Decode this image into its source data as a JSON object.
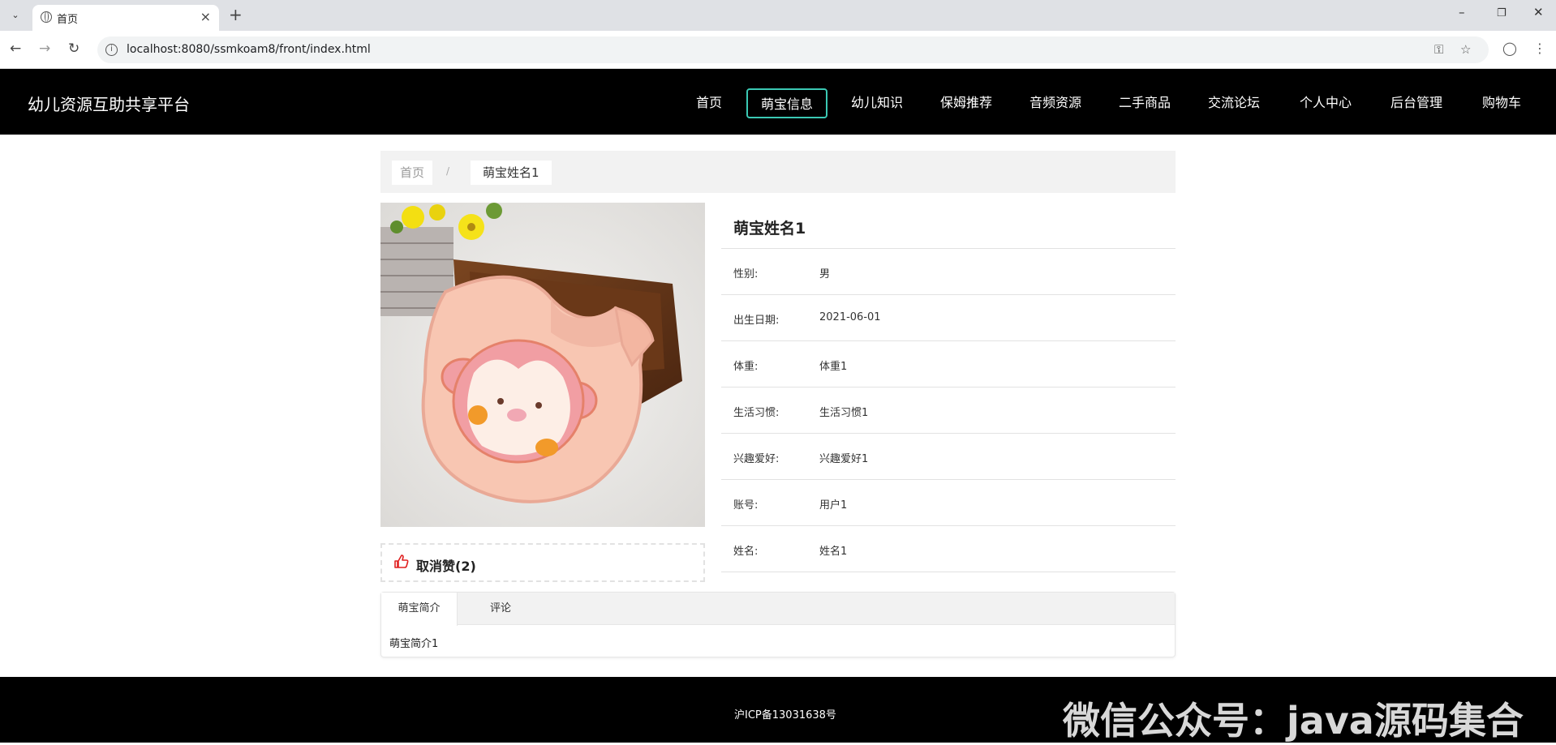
{
  "browser": {
    "tab_title": "首页",
    "url": "localhost:8080/ssmkoam8/front/index.html"
  },
  "site": {
    "logo": "幼儿资源互助共享平台",
    "nav": [
      "首页",
      "萌宝信息",
      "幼儿知识",
      "保姆推荐",
      "音频资源",
      "二手商品",
      "交流论坛",
      "个人中心",
      "后台管理",
      "购物车"
    ],
    "active_nav": "萌宝信息"
  },
  "breadcrumb": {
    "home": "首页",
    "separator": "/",
    "current": "萌宝姓名1"
  },
  "detail": {
    "title": "萌宝姓名1",
    "rows": [
      {
        "label": "性别:",
        "value": "男"
      },
      {
        "label": "出生日期:",
        "value": "2021-06-01"
      },
      {
        "label": "体重:",
        "value": "体重1"
      },
      {
        "label": "生活习惯:",
        "value": "生活习惯1"
      },
      {
        "label": "兴趣爱好:",
        "value": "兴趣爱好1"
      },
      {
        "label": "账号:",
        "value": "用户1"
      },
      {
        "label": "姓名:",
        "value": "姓名1"
      }
    ]
  },
  "like": {
    "label": "取消赞(2)"
  },
  "tabs": {
    "items": [
      "萌宝简介",
      "评论"
    ],
    "active_content": "萌宝简介1"
  },
  "footer": {
    "icp": "沪ICP备13031638号",
    "watermark": "微信公众号：java源码集合"
  },
  "colors": {
    "accent": "#3bc9b4",
    "header_bg": "#000000",
    "like_icon": "#e02020"
  }
}
